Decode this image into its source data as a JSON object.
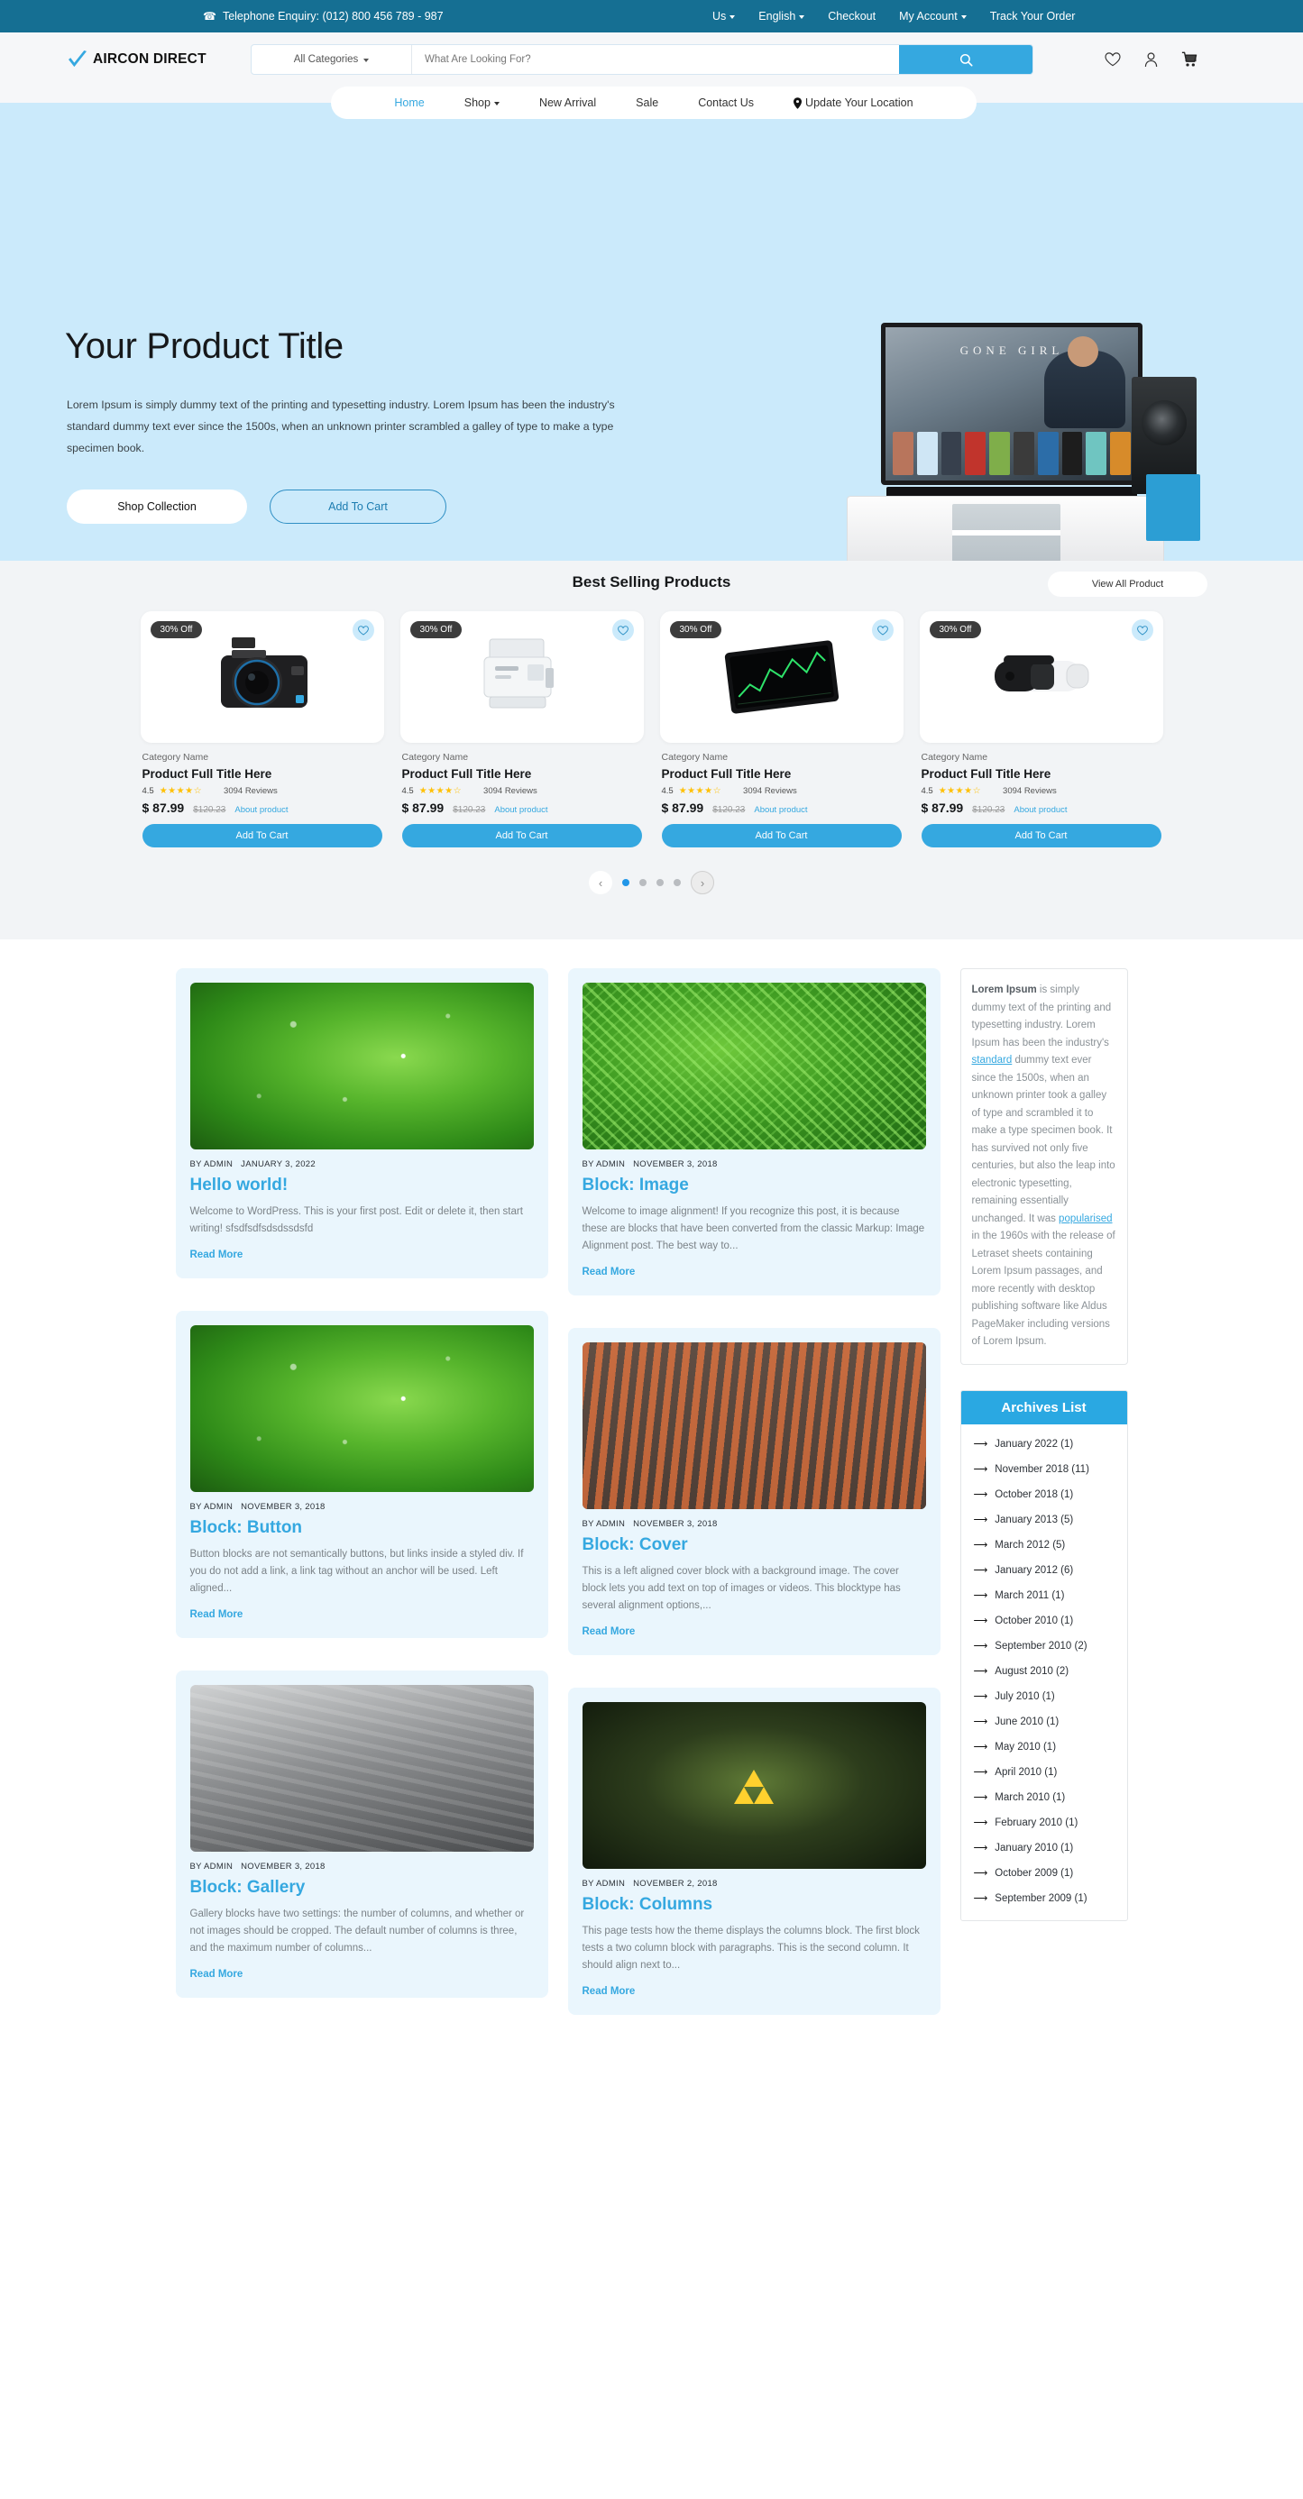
{
  "topbar": {
    "phone_icon": "phone-icon",
    "phone": "Telephone Enquiry: (012) 800 456 789 - 987",
    "links": [
      {
        "label": "Us",
        "caret": true
      },
      {
        "label": "English",
        "caret": true
      },
      {
        "label": "Checkout",
        "caret": false
      },
      {
        "label": "My Account",
        "caret": true
      },
      {
        "label": "Track Your Order",
        "caret": false
      }
    ]
  },
  "header": {
    "brand": "AIRCON DIRECT",
    "brand_icon": "check-mark-icon",
    "category_select": "All Categories",
    "search_placeholder": "What Are Looking For?",
    "search_value": "",
    "search_icon": "search-icon",
    "icons": [
      "heart-icon",
      "user-icon",
      "cart-icon"
    ]
  },
  "nav": {
    "items": [
      {
        "label": "Home",
        "active": true,
        "caret": false,
        "pin": false
      },
      {
        "label": "Shop",
        "active": false,
        "caret": true,
        "pin": false
      },
      {
        "label": "New Arrival",
        "active": false,
        "caret": false,
        "pin": false
      },
      {
        "label": "Sale",
        "active": false,
        "caret": false,
        "pin": false
      },
      {
        "label": "Contact Us",
        "active": false,
        "caret": false,
        "pin": false
      },
      {
        "label": "Update Your Location",
        "active": false,
        "caret": false,
        "pin": true
      }
    ]
  },
  "hero": {
    "title": "Your Product Title",
    "description": "Lorem Ipsum is simply dummy text of the printing and typesetting industry. Lorem Ipsum has been the industry's standard dummy text ever since the 1500s, when an unknown printer scrambled a galley of  type to make a type specimen book.",
    "btn_primary": "Shop Collection",
    "btn_secondary": "Add To Cart",
    "pager": [
      "1",
      "2",
      "3",
      "4"
    ],
    "pager_active": 0,
    "prev_icon": "chevron-left-icon",
    "next_icon": "chevron-right-icon",
    "image_caption": "GONE GIRL",
    "bg_color": "#cbeafb"
  },
  "best_selling": {
    "title": "Best Selling Products",
    "view_all_label": "View All Product",
    "accent_color": "#35a8e0",
    "products": [
      {
        "badge": "30% Off",
        "category": "Category Name",
        "title": "Product Full Title Here",
        "rating": "4.5",
        "stars": "★★★★☆",
        "reviews": "3094 Reviews",
        "price": "$ 87.99",
        "old_price": "$120.23",
        "about": "About product",
        "cta": "Add To Cart",
        "image": "camera"
      },
      {
        "badge": "30% Off",
        "category": "Category Name",
        "title": "Product Full Title Here",
        "rating": "4.5",
        "stars": "★★★★☆",
        "reviews": "3094 Reviews",
        "price": "$ 87.99",
        "old_price": "$120.23",
        "about": "About product",
        "cta": "Add To Cart",
        "image": "printer"
      },
      {
        "badge": "30% Off",
        "category": "Category Name",
        "title": "Product Full Title Here",
        "rating": "4.5",
        "stars": "★★★★☆",
        "reviews": "3094 Reviews",
        "price": "$ 87.99",
        "old_price": "$120.23",
        "about": "About product",
        "cta": "Add To Cart",
        "image": "tablet"
      },
      {
        "badge": "30% Off",
        "category": "Category Name",
        "title": "Product Full Title Here",
        "rating": "4.5",
        "stars": "★★★★☆",
        "reviews": "3094 Reviews",
        "price": "$ 87.99",
        "old_price": "$120.23",
        "about": "About product",
        "cta": "Add To Cart",
        "image": "vr"
      }
    ],
    "dots": 4,
    "dots_active": 0
  },
  "blog": {
    "column_left": [
      {
        "image": "leaf-water-drops",
        "author": "BY ADMIN",
        "date": "JANUARY 3, 2022",
        "title": "Hello world!",
        "excerpt": "Welcome to WordPress. This is your first post. Edit or delete it, then start writing! sfsdfsdfsdsdssdsfd",
        "read_more": "Read More"
      },
      {
        "image": "leaf-water-drops",
        "author": "BY ADMIN",
        "date": "NOVEMBER 3, 2018",
        "title": "Block: Button",
        "excerpt": "Button blocks are not semantically buttons, but links inside a styled div.  If you do not add a link, a link tag without an anchor will be used. Left aligned...",
        "read_more": "Read More"
      },
      {
        "image": "grayscale-road",
        "author": "BY ADMIN",
        "date": "NOVEMBER 3, 2018",
        "title": "Block: Gallery",
        "excerpt": "Gallery blocks have two settings: the number of columns, and whether or not images should be cropped. The default number of columns is three, and the maximum number of columns...",
        "read_more": "Read More"
      }
    ],
    "column_right": [
      {
        "image": "fern-green",
        "author": "BY ADMIN",
        "date": "NOVEMBER 3, 2018",
        "title": "Block: Image",
        "excerpt": "Welcome to image alignment! If you recognize this post, it is because these are blocks that have been converted from the classic Markup: Image Alignment post. The best way to...",
        "read_more": "Read More"
      },
      {
        "image": "ribs-grill",
        "author": "BY ADMIN",
        "date": "NOVEMBER 3, 2018",
        "title": "Block: Cover",
        "excerpt": "This is a left aligned cover block with a background image. The cover block lets you add text on top of images or videos. This blocktype has several alignment options,...",
        "read_more": "Read More"
      },
      {
        "image": "dark-triangle",
        "author": "BY ADMIN",
        "date": "NOVEMBER 2, 2018",
        "title": "Block: Columns",
        "excerpt": "This page tests how the theme displays the columns block. The first block tests a two column block with paragraphs. This is the second column. It should align next to...",
        "read_more": "Read More"
      }
    ]
  },
  "sidebar": {
    "text_parts": {
      "bold_lead": "Lorem Ipsum",
      "p1": " is simply dummy text of the printing and typesetting industry. Lorem Ipsum has been the industry's ",
      "link1": "standard",
      "p2": " dummy text ever since the 1500s, when an unknown printer took a galley of type and scrambled it to make a type specimen book. It has survived not only five centuries, but also the leap into electronic typesetting, remaining essentially unchanged. It was ",
      "link2": "popularised",
      "p3": " in the 1960s with the release of Letraset sheets containing Lorem Ipsum passages, and more recently with desktop publishing software like Aldus PageMaker including versions of Lorem Ipsum."
    },
    "archives_title": "Archives List",
    "archives": [
      "January 2022 (1)",
      "November 2018 (11)",
      "October 2018 (1)",
      "January 2013 (5)",
      "March 2012 (5)",
      "January 2012 (6)",
      "March 2011 (1)",
      "October 2010 (1)",
      "September 2010 (2)",
      "August 2010 (2)",
      "July 2010 (1)",
      "June 2010 (1)",
      "May 2010 (1)",
      "April 2010 (1)",
      "March 2010 (1)",
      "February 2010 (1)",
      "January 2010 (1)",
      "October 2009 (1)",
      "September 2009 (1)"
    ]
  }
}
